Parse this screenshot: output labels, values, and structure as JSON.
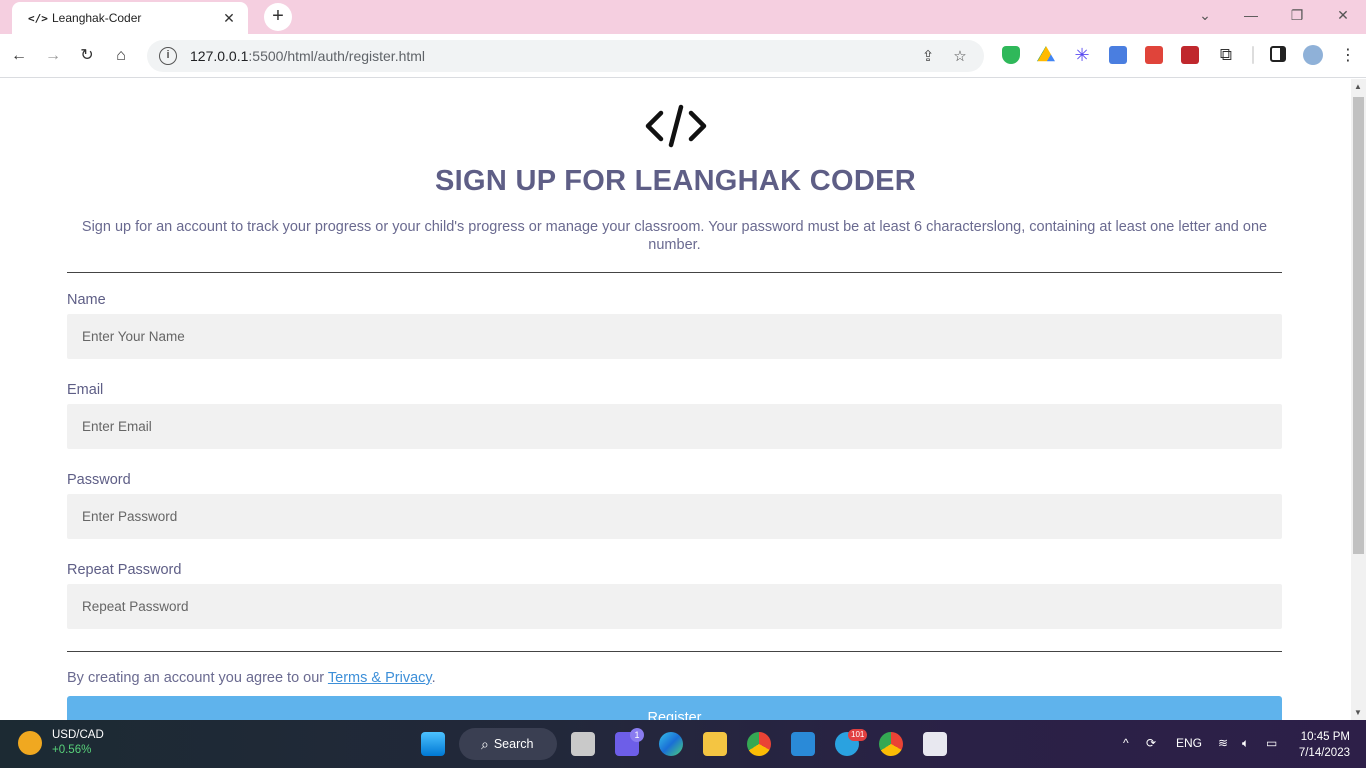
{
  "browser": {
    "tab_title": "Leanghak-Coder",
    "tab_favicon": "</>",
    "url_host": "127.0.0.1",
    "url_path": ":5500/html/auth/register.html",
    "window_controls": [
      "chevron-down",
      "minimize",
      "restore",
      "close"
    ]
  },
  "page": {
    "logo_text": "</>",
    "title": "SIGN UP FOR LEANGHAK CODER",
    "intro": "Sign up for an account to track your progress or your child's progress or manage your classroom. Your password must be at least 6 characterslong, containing at least one letter and one number.",
    "fields": [
      {
        "label": "Name",
        "placeholder": "Enter Your Name"
      },
      {
        "label": "Email",
        "placeholder": "Enter Email"
      },
      {
        "label": "Password",
        "placeholder": "Enter Password"
      },
      {
        "label": "Repeat Password",
        "placeholder": "Repeat Password"
      }
    ],
    "agree_text": "By creating an account you agree to our ",
    "agree_link": "Terms & Privacy",
    "agree_end": ".",
    "register_label": "Register"
  },
  "taskbar": {
    "widget_pair": "USD/CAD",
    "widget_change": "+0.56%",
    "search_label": "Search",
    "lang": "ENG",
    "time": "10:45 PM",
    "date": "7/14/2023",
    "teams_badge": "1",
    "telegram_badge": "101"
  }
}
